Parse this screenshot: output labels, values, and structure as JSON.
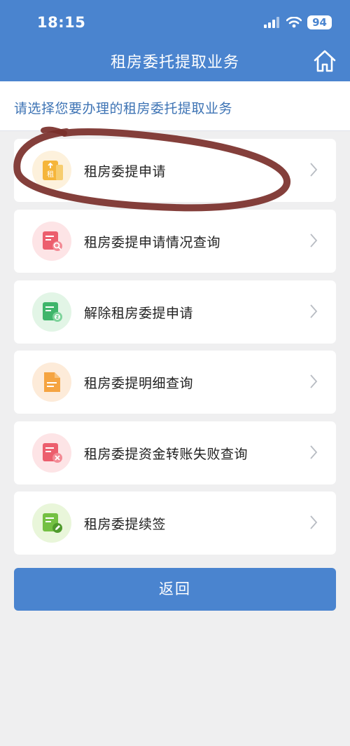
{
  "status_bar": {
    "time": "18:15",
    "battery": "94"
  },
  "header": {
    "title": "租房委托提取业务"
  },
  "subheader": {
    "text": "请选择您要办理的租房委托提取业务"
  },
  "menu": [
    {
      "label": "租房委提申请",
      "icon": "rent-apply-icon",
      "icon_char": "租"
    },
    {
      "label": "租房委提申请情况查询",
      "icon": "search-doc-icon"
    },
    {
      "label": "解除租房委提申请",
      "icon": "cancel-link-doc-icon"
    },
    {
      "label": "租房委提明细查询",
      "icon": "detail-doc-icon"
    },
    {
      "label": "租房委提资金转账失败查询",
      "icon": "transfer-fail-doc-icon"
    },
    {
      "label": "租房委提续签",
      "icon": "renew-doc-icon"
    }
  ],
  "back_button": {
    "label": "返回"
  },
  "colors": {
    "header": "#4a84cf",
    "accent_text": "#3d73b4",
    "marker": "#7a2f2a"
  }
}
